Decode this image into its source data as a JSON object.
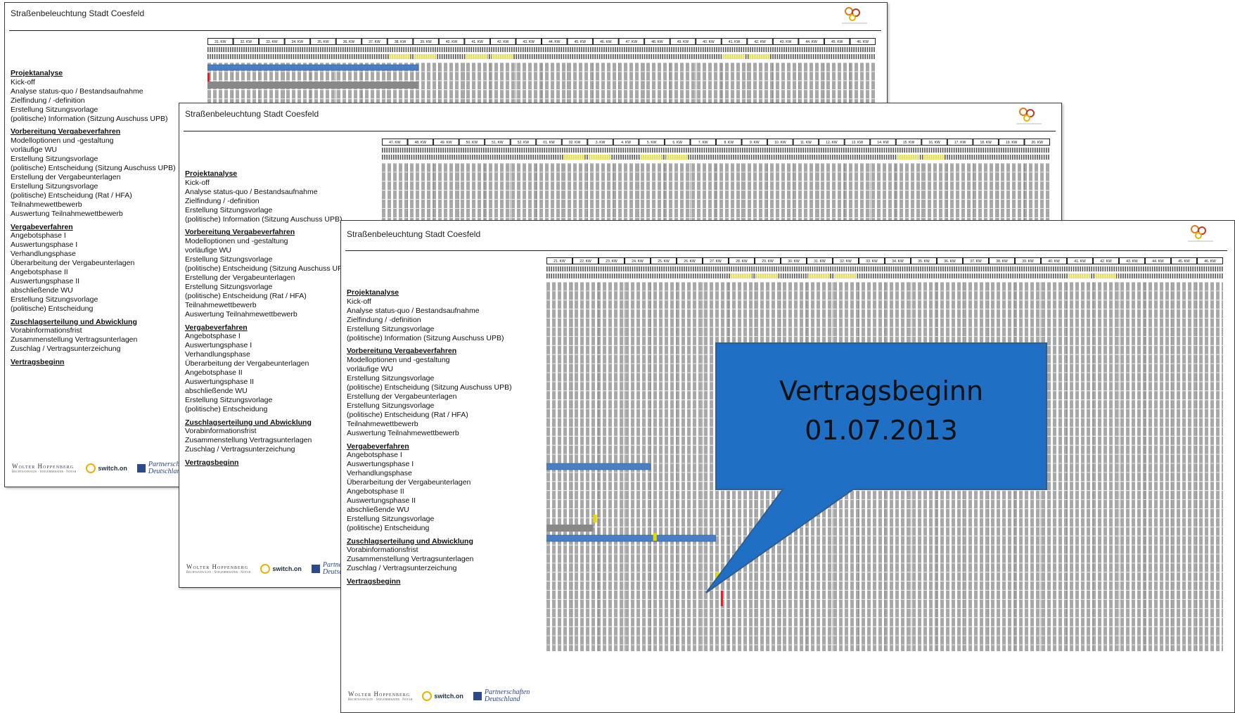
{
  "document": {
    "title": "Straßenbeleuchtung Stadt Coesfeld",
    "callout": {
      "line1": "Vertragsbeginn",
      "line2": "01.07.2013",
      "fill": "#1F6FC5"
    },
    "colors": {
      "bar_blue": "#4A7EC4",
      "highlight_yellow": "#F5F07A",
      "milestone_red": "#E02020",
      "grid_gray": "#A8A8A8"
    },
    "sheet_weeks": [
      [
        "31. KW",
        "32. KW",
        "33. KW",
        "34. KW",
        "35. KW",
        "36. KW",
        "37. KW",
        "38. KW",
        "39. KW",
        "40. KW",
        "41. KW",
        "42. KW",
        "43. KW",
        "44. KW",
        "45. KW",
        "46. KW",
        "47. KW",
        "48. KW",
        "49. KW",
        "40. KW",
        "41. KW",
        "42. KW",
        "43. KW",
        "44. KW",
        "45. KW",
        "46. KW"
      ],
      [
        "47. KW",
        "48. KW",
        "49. KW",
        "50. KW",
        "51. KW",
        "52. KW",
        "01. KW",
        "02. KW",
        "3. KW",
        "4. KW",
        "5. KW",
        "6. KW",
        "7. KW",
        "8. KW",
        "9. KW",
        "10. KW",
        "11. KW",
        "12. KW",
        "13. KW",
        "14. KW",
        "15. KW",
        "16. KW",
        "17. KW",
        "18. KW",
        "19. KW",
        "20. KW"
      ],
      [
        "21. KW",
        "22. KW",
        "23. KW",
        "24. KW",
        "25. KW",
        "26. KW",
        "27. KW",
        "28. KW",
        "29. KW",
        "30. KW",
        "31. KW",
        "32. KW",
        "33. KW",
        "34. KW",
        "35. KW",
        "36. KW",
        "37. KW",
        "38. KW",
        "39. KW",
        "40. KW",
        "41. KW",
        "42. KW",
        "43. KW",
        "44. KW",
        "45. KW",
        "46. KW"
      ]
    ],
    "sections": [
      {
        "heading": "Projektanalyse",
        "items": [
          "Kick-off",
          "Analyse status-quo / Bestandsaufnahme",
          "Zielfindung / -definition",
          "Erstellung Sitzungsvorlage",
          "(politische) Information (Sitzung Auschuss UPB)"
        ]
      },
      {
        "heading": "Vorbereitung Vergabeverfahren",
        "items": [
          "Modelloptionen und -gestaltung",
          "vorläufige WU",
          "Erstellung Sitzungsvorlage",
          "(politische) Entscheidung (Sitzung Auschuss UPB)",
          "Erstellung der Vergabeunterlagen",
          "Erstellung Sitzungsvorlage",
          "(politische) Entscheidung (Rat / HFA)",
          "Teilnahmewettbewerb",
          "Auswertung Teilnahmewettbewerb"
        ]
      },
      {
        "heading": "Vergabeverfahren",
        "items": [
          "Angebotsphase I",
          "Auswertungsphase I",
          "Verhandlungsphase",
          "Überarbeitung der Vergabeunterlagen",
          "Angebotsphase II",
          "Auswertungsphase II",
          "abschließende WU",
          "Erstellung Sitzungsvorlage",
          "(politische) Entscheidung"
        ]
      },
      {
        "heading": "Zuschlagserteilung und Abwicklung",
        "items": [
          "Vorabinformationsfrist",
          "Zusammenstellung Vertragsunterlagen",
          "Zuschlag / Vertragsunterzeichung"
        ]
      },
      {
        "heading": "Vertragsbeginn",
        "items": []
      }
    ],
    "footer": {
      "wolter": "Wolter Hoppenberg",
      "wolter_sub": "Rechtsanwälte · Steuerberater · Notar",
      "switch": "switch.on",
      "partner_line1": "Partnerschaften",
      "partner_line2": "Deutschland"
    }
  }
}
